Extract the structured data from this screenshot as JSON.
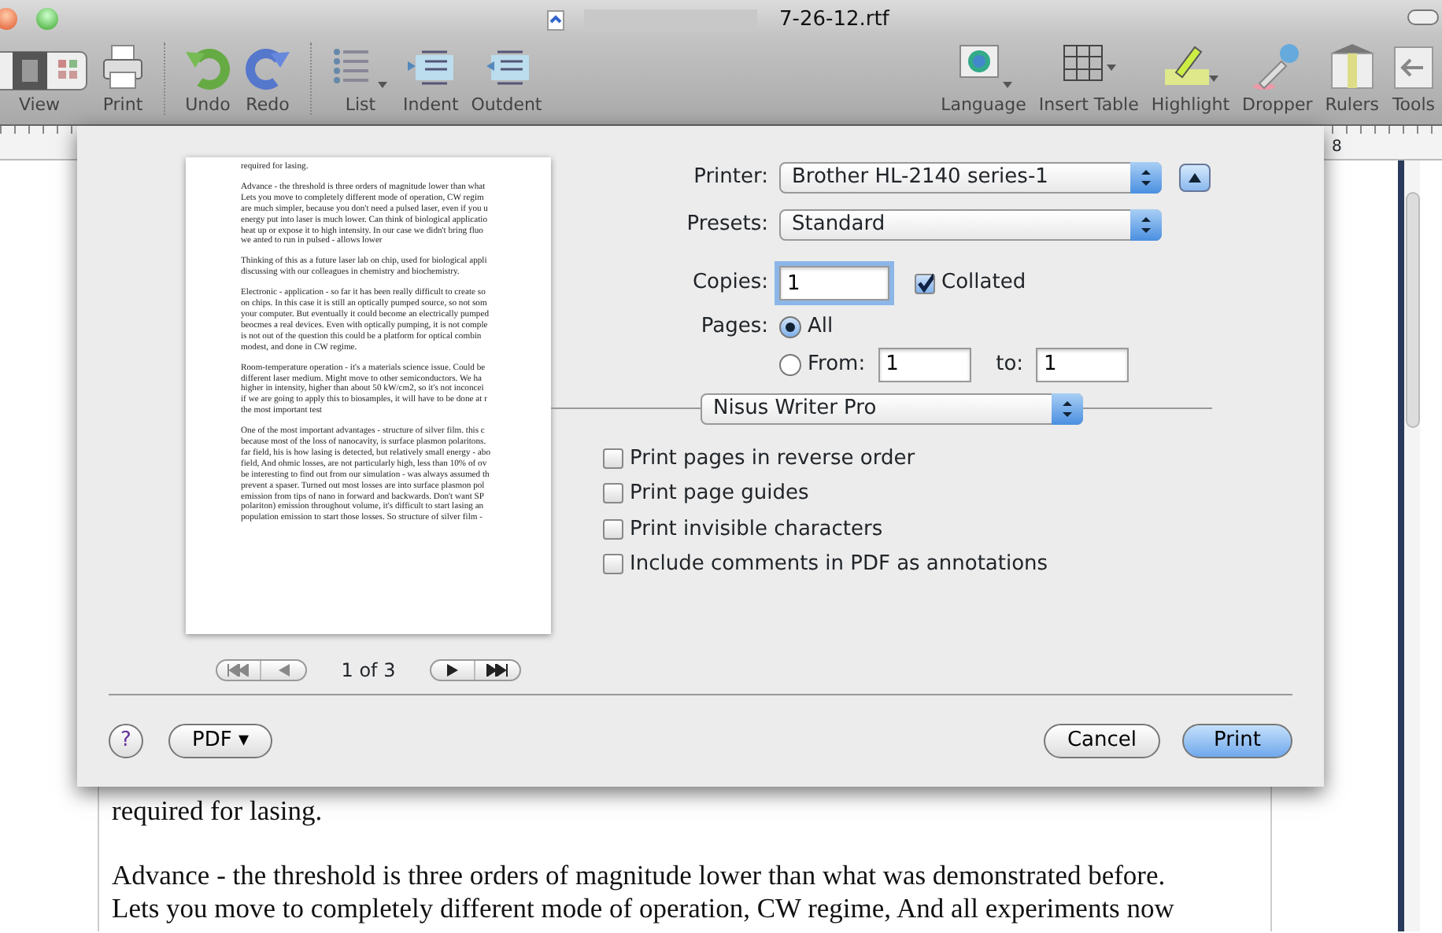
{
  "window": {
    "title": "7-26-12.rtf"
  },
  "toolbar": {
    "left": [
      {
        "kind": "view",
        "label": "View",
        "separator_before": false
      },
      {
        "kind": "printer",
        "label": "Print",
        "separator_before": false
      },
      {
        "kind": "undo",
        "label": "Undo",
        "separator_before": true
      },
      {
        "kind": "redo",
        "label": "Redo",
        "separator_before": false
      },
      {
        "kind": "list",
        "label": "List",
        "separator_before": true
      },
      {
        "kind": "indent",
        "label": "Indent",
        "separator_before": false
      },
      {
        "kind": "outdent",
        "label": "Outdent",
        "separator_before": false
      }
    ],
    "right": [
      {
        "kind": "language",
        "label": "Language"
      },
      {
        "kind": "table",
        "label": "Insert Table"
      },
      {
        "kind": "highlight",
        "label": "Highlight"
      },
      {
        "kind": "dropper",
        "label": "Dropper"
      },
      {
        "kind": "rulers",
        "label": "Rulers"
      },
      {
        "kind": "tools",
        "label": "Tools"
      }
    ]
  },
  "ruler": {
    "label": "8"
  },
  "document": {
    "paragraphs": [
      "required for lasing.",
      "Advance - the threshold is three orders of magnitude lower than what was demonstrated before.",
      "Lets you move to completely different mode of operation, CW regime, And all experiments now"
    ]
  },
  "print_dialog": {
    "preview": {
      "paragraphs": [
        [
          "required for lasing."
        ],
        [
          "Advance - the threshold is three orders of magnitude lower than what",
          "Lets you move to completely different mode of operation, CW regim",
          "are much simpler, because you don't need a pulsed laser, even if you u",
          "energy put into laser is much lower. Can think of biological applicatio",
          "heat up or expose it to high intensity. In our case we didn't bring fluo",
          "we anted to run in pulsed - allows lower"
        ],
        [
          "Thinking of this as a future laser lab on chip, used for biological appli",
          "discussing with our colleagues in chemistry and biochemistry."
        ],
        [
          "Electronic - application - so far it has been really difficult to create so",
          "on chips. In this case it is still an optically pumped source, so not som",
          "your computer. But eventually it could become an electrically pumped",
          "beocmes a real devices. Even with optically pumping, it is not comple",
          "is not out of the question this could be a platform for optical combin",
          "modest, and done in CW regime."
        ],
        [
          "Room-temperature operation - it's a materials science issue. Could be",
          "different laser medium. Might move to other semiconductors. We ha",
          "higher in intensity, higher than about 50 kW/cm2, so it's not inconcei",
          "if we are going to apply this to biosamples, it will have to be done at r",
          "the most important test"
        ],
        [
          "One of the most important advantages - structure of silver film. this c",
          "because most of the loss of nanocavity, is surface plasmon polaritons.",
          "far field, his is how lasing is detected, but relatively small energy - abo",
          "field, And ohmic losses, are not particularly high, less than 10% of ov",
          "be interesting to find out from our simulation - was always assumed th",
          "prevent a spaser. Turned out most losses are into surface plasmon pol",
          "emission from tips of nano in forward and backwards. Don't want SP",
          "polariton) emission throughout volume, it's difficult to start lasing an",
          "population emission to start those losses. So structure of silver film -"
        ]
      ],
      "page_indicator": "1 of 3"
    },
    "printer": {
      "label": "Printer:",
      "value": "Brother HL-2140 series-1"
    },
    "presets": {
      "label": "Presets:",
      "value": "Standard"
    },
    "copies": {
      "label": "Copies:",
      "value": "1"
    },
    "collated": {
      "label": "Collated",
      "checked": true
    },
    "pages": {
      "label": "Pages:",
      "options": [
        {
          "label": "All",
          "selected": true
        },
        {
          "label": "From:",
          "selected": false
        }
      ],
      "from": "1",
      "to_label": "to:",
      "to": "1"
    },
    "section": "Nisus Writer Pro",
    "options": [
      {
        "label": "Print pages in reverse order",
        "checked": false
      },
      {
        "label": "Print page guides",
        "checked": false
      },
      {
        "label": "Print invisible characters",
        "checked": false
      },
      {
        "label": "Include comments in PDF as annotations",
        "checked": false
      }
    ],
    "help": "?",
    "pdf": "PDF ▾",
    "buttons": [
      {
        "label": "Cancel",
        "default": false
      },
      {
        "label": "Print",
        "default": true
      }
    ]
  }
}
